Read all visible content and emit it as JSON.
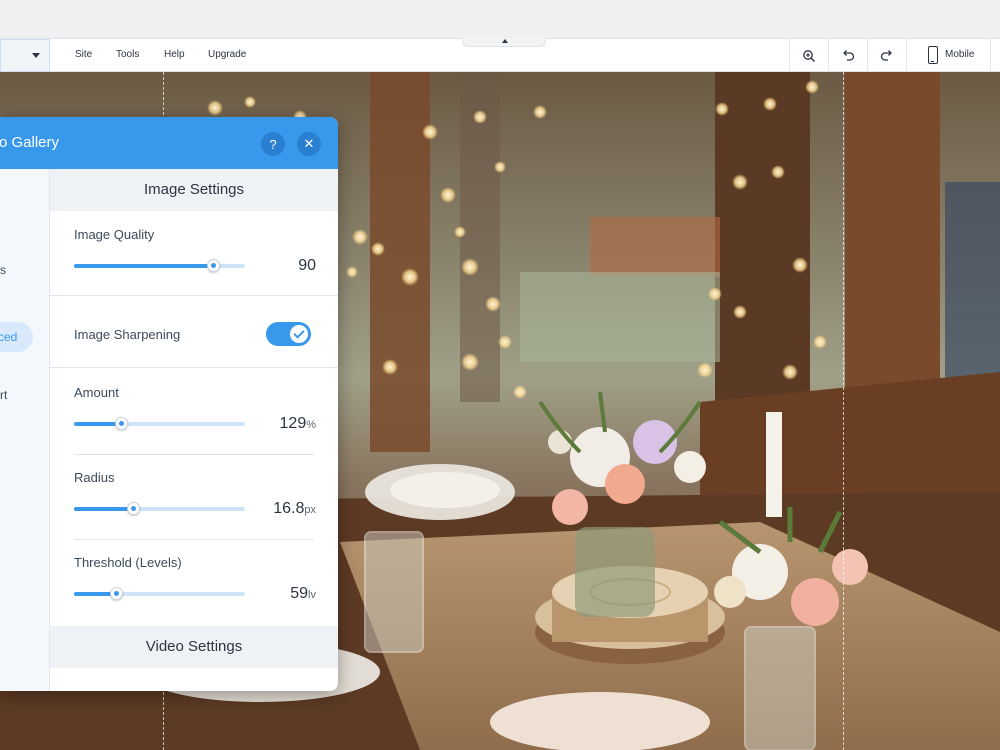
{
  "toolbar": {
    "menu": [
      "Site",
      "Tools",
      "Help",
      "Upgrade"
    ],
    "zoom_icon": "zoom-in-icon",
    "undo_icon": "undo-icon",
    "redo_icon": "redo-icon",
    "mobile_label": "Mobile",
    "mobile_icon": "mobile-phone-icon"
  },
  "panel": {
    "title": "ro Gallery",
    "help_label": "?",
    "close_label": "✕",
    "nav": [
      {
        "label": "s"
      },
      {
        "label": "ced",
        "active": true
      },
      {
        "label": "rt"
      }
    ],
    "image_settings": {
      "header": "Image Settings",
      "quality": {
        "label": "Image Quality",
        "value": "90",
        "unit": "",
        "percent": 82
      },
      "sharpening": {
        "label": "Image Sharpening",
        "enabled": true
      },
      "amount": {
        "label": "Amount",
        "value": "129",
        "unit": "%",
        "percent": 28
      },
      "radius": {
        "label": "Radius",
        "value": "16.8",
        "unit": "px",
        "percent": 35
      },
      "threshold": {
        "label": "Threshold (Levels)",
        "value": "59",
        "unit": "lv",
        "percent": 25
      }
    },
    "video_settings": {
      "header": "Video Settings"
    }
  },
  "colors": {
    "accent": "#3899ec",
    "panel_header": "#3899ec"
  }
}
